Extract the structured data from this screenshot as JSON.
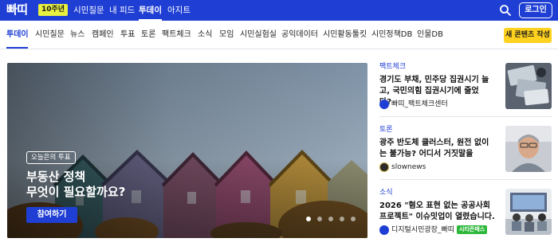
{
  "header": {
    "logo": "빠띠",
    "anniversary_badge": "10주년",
    "nav": [
      {
        "label": "시민질문"
      },
      {
        "label": "내 피드"
      },
      {
        "label": "투데이",
        "active": true
      },
      {
        "label": "아지트"
      }
    ],
    "login_label": "로그인",
    "search_icon": "search-icon",
    "accent_color": "#1f3fd4"
  },
  "categories": {
    "items": [
      {
        "label": "투데이",
        "active": true
      },
      {
        "label": "시민질문"
      },
      {
        "label": "뉴스"
      },
      {
        "label": "캠페인"
      },
      {
        "label": "투표"
      },
      {
        "label": "토론"
      },
      {
        "label": "팩트체크"
      },
      {
        "label": "소식"
      },
      {
        "label": "모임"
      },
      {
        "label": "시민실험실"
      },
      {
        "label": "공익데이터"
      },
      {
        "label": "시민활동툴킷"
      },
      {
        "label": "시민정책DB"
      },
      {
        "label": "인물DB"
      }
    ],
    "write_button": "새 콘텐츠 작성",
    "write_button_color": "#ffd21f"
  },
  "hero": {
    "tag": "오늘은의 투표",
    "title_line1": "부동산 정책",
    "title_line2": "무엇이 필요할까요?",
    "cta": "참여하기",
    "slide_count": 5,
    "active_slide": 1
  },
  "articles": [
    {
      "category": "팩트체크",
      "title": "경기도 부채, 민주당 집권시기 늘고, 국민의힘 집권시기에 줄었다?",
      "author": "빠띠_팩트체크센터",
      "avatar_icon": "parti-logo-icon"
    },
    {
      "category": "토론",
      "title": "광주 반도체 클러스터, 원전 없이는 불가능? 어디서 거짓말을",
      "author": "slownews",
      "avatar_icon": "slownews-logo-icon"
    },
    {
      "category": "소식",
      "title": "2026 \"혐오 표현 없는 공공사회 프로젝트\" 이슈밋업이 열렸습니다.",
      "author": "디지털시민광장_빠띠",
      "badge": "시티즌패스",
      "avatar_icon": "parti-logo-icon",
      "badge_color": "#2eb83a"
    }
  ]
}
